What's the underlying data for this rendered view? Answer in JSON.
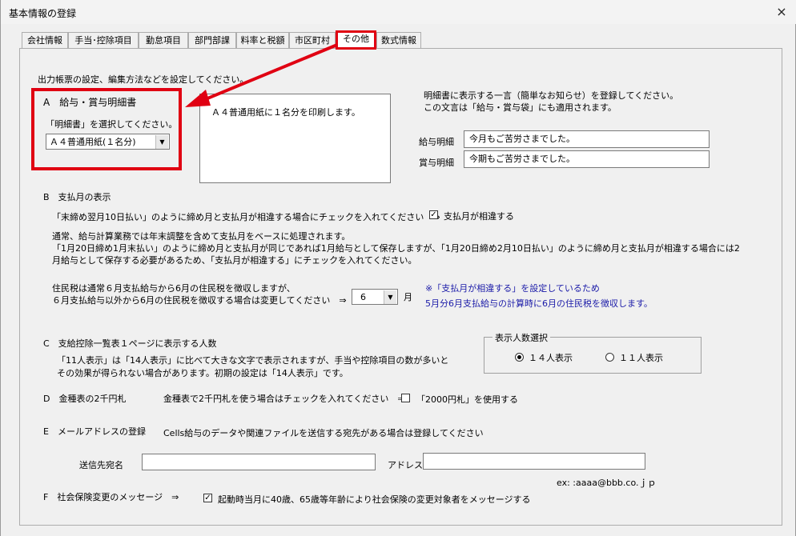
{
  "window": {
    "title": "基本情報の登録",
    "close_icon": "×"
  },
  "tabs": [
    {
      "label": "会社情報",
      "active": false
    },
    {
      "label": "手当･控除項目",
      "active": false
    },
    {
      "label": "勤怠項目",
      "active": false
    },
    {
      "label": "部門部課",
      "active": false
    },
    {
      "label": "料率と税額",
      "active": false
    },
    {
      "label": "市区町村",
      "active": false
    },
    {
      "label": "その他",
      "active": true
    },
    {
      "label": "数式情報",
      "active": false
    }
  ],
  "intro": "出力帳票の設定、編集方法などを設定してください。",
  "sectionA": {
    "title": "A　給与・賞与明細書",
    "prompt": "「明細書」を選択してください。",
    "select_value": "Ａ４普通用紙(１名分)",
    "preview_text": "Ａ４普通用紙に１名分を印刷します。",
    "notice_line1": "明細書に表示する一言（簡単なお知らせ）を登録してください。",
    "notice_line2": "この文言は「給与・賞与袋」にも適用されます。",
    "salary_label": "給与明細",
    "salary_value": "今月もご苦労さまでした。",
    "bonus_label": "賞与明細",
    "bonus_value": "今期もご苦労さまでした。"
  },
  "sectionB": {
    "title": "B　支払月の表示",
    "check_prompt": "「末締め翌月10日払い」のように締め月と支払月が相違する場合にチェックを入れてください　⇒",
    "check_label": "支払月が相違する",
    "check_checked": true,
    "desc1": "通常、給与計算業務では年末調整を含めて支払月をベースに処理されます。",
    "desc2": "「1月20日締め1月末払い」のように締め月と支払月が同じであれば1月給与として保存しますが、「1月20日締め2月10日払い」のように締め月と支払月が相違する場合には2",
    "desc3": "月給与として保存する必要があるため、「支払月が相違する」にチェックを入れてください。",
    "tax1": "住民税は通常６月支払給与から6月の住民税を徴収しますが、",
    "tax2": "６月支払給与以外から6月の住民税を徴収する場合は変更してください　⇒",
    "month_value": "6",
    "month_unit": "月",
    "note1": "※「支払月が相違する」を設定しているため",
    "note2": "5月分6月支払給与の計算時に6月の住民税を徴収します。"
  },
  "sectionC": {
    "title": "C　支給控除一覧表１ページに表示する人数",
    "desc1": "「11人表示」は「14人表示」に比べて大きな文字で表示されますが、手当や控除項目の数が多いと",
    "desc2": "その効果が得られない場合があります。初期の設定は「14人表示」です。",
    "group_title": "表示人数選択",
    "option14": "１４人表示",
    "option11": "１１人表示",
    "selected": "14"
  },
  "sectionD": {
    "title": "D　金種表の2千円札",
    "prompt": "金種表で2千円札を使う場合はチェックを入れてください　⇒",
    "check_label": "「2000円札」を使用する",
    "check_checked": false
  },
  "sectionE": {
    "title": "E　メールアドレスの登録",
    "desc": "Cells給与のデータや関連ファイルを送信する宛先がある場合は登録してください",
    "name_label": "送信先宛名",
    "name_value": "",
    "address_label": "アドレス",
    "address_value": "",
    "example": "ex: :aaaa@bbb.co.ｊｐ"
  },
  "sectionF": {
    "title": "F　社会保険変更のメッセージ　⇒",
    "check_label": "起動時当月に40歳、65歳等年齢により社会保険の変更対象者をメッセージする",
    "check_checked": true
  },
  "colors": {
    "highlight": "#e00012",
    "note": "#1a1aa8"
  }
}
